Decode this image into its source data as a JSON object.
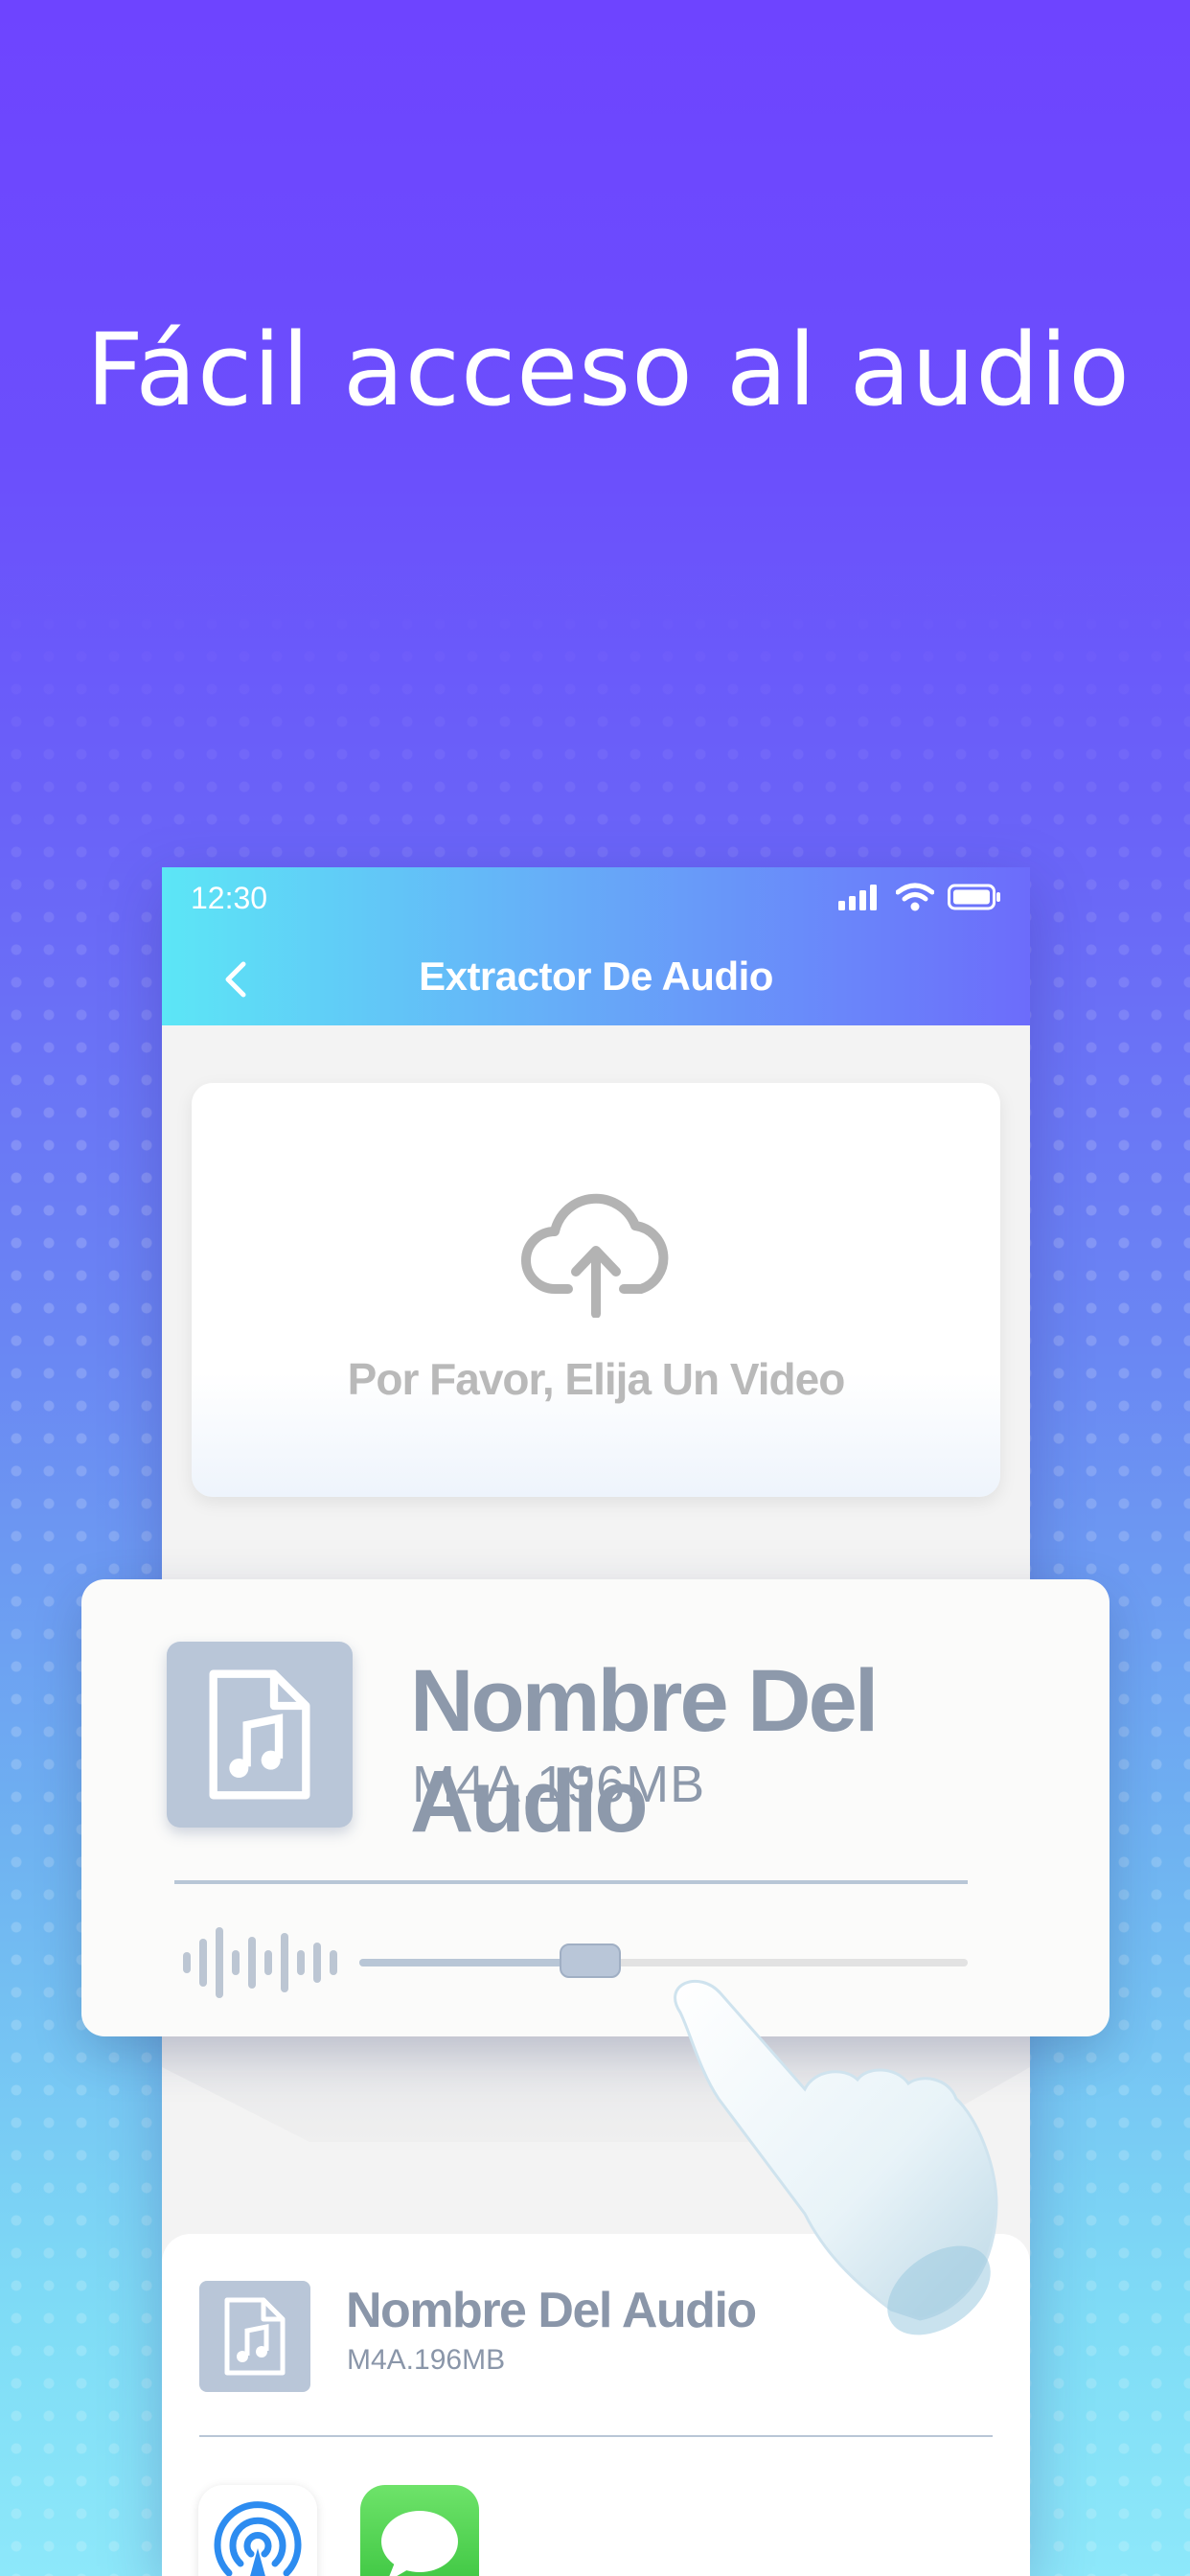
{
  "headline": "Fácil acceso al audio",
  "colors": {
    "accent": "#6c6cfb",
    "appbar_start": "#5ce6f6",
    "file_icon": "#b9c6d8",
    "file_text": "#8d99ab"
  },
  "phone": {
    "status_bar": {
      "time": "12:30",
      "icons": [
        "signal-icon",
        "wifi-icon",
        "battery-icon"
      ]
    },
    "app_bar": {
      "back_icon": "chevron-left-icon",
      "title": "Extractor De Audio"
    },
    "upload": {
      "icon": "cloud-upload-icon",
      "label": "Por Favor, Elija Un Video"
    },
    "audio_list_item": {
      "icon": "music-file-icon",
      "name": "Nombre Del Audio",
      "meta": "M4A.196MB"
    },
    "share_targets": [
      {
        "icon": "airdrop-icon"
      },
      {
        "icon": "messages-icon"
      }
    ]
  },
  "audio_card": {
    "icon": "music-file-icon",
    "name": "Nombre Del Audio",
    "meta": "M4A.196MB",
    "playback_position": 0.38,
    "waveform_icon": "waveform-icon"
  },
  "decoration": {
    "hand_icon": "pointing-hand-icon"
  }
}
